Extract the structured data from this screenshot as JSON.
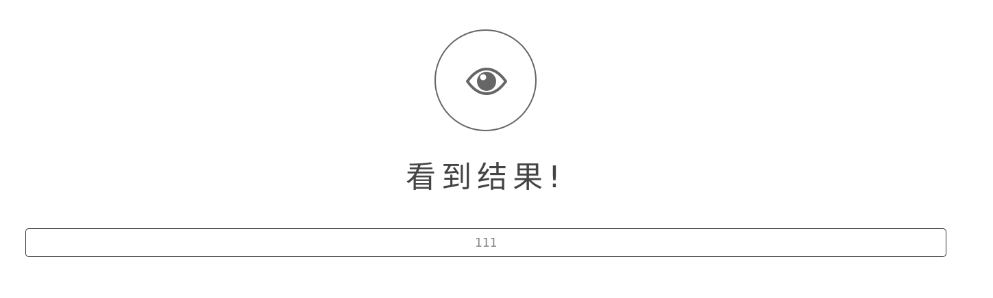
{
  "result": {
    "icon": "eye-icon",
    "title": "看到结果!",
    "value": "111"
  },
  "colors": {
    "icon": "#666666",
    "title": "#444444",
    "field_border": "#333333",
    "value_text": "#888888"
  }
}
